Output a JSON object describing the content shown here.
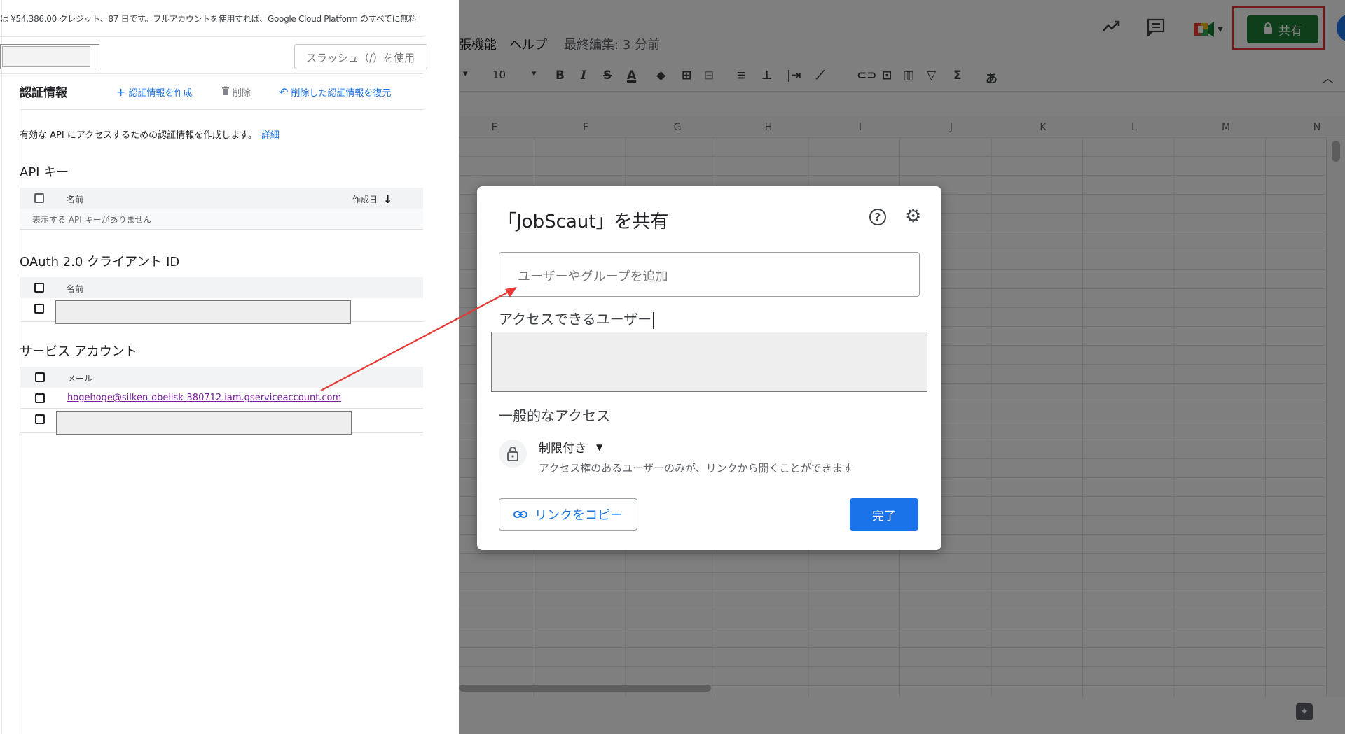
{
  "console": {
    "banner": "は ¥54,386.00 クレジット、87 日です。フルアカウントを使用すれば、Google Cloud Platform のすべてに無料",
    "search_placeholder": "スラッシュ（/）を使用",
    "credentials_title": "認証情報",
    "create_label": "認証情報を作成",
    "delete_label": "削除",
    "restore_label": "削除した認証情報を復元",
    "intro": "有効な API にアクセスするための認証情報を作成します。",
    "details_link": "詳細",
    "api_keys": {
      "title": "API キー",
      "col_name": "名前",
      "col_created": "作成日",
      "empty": "表示する API キーがありません"
    },
    "oauth": {
      "title": "OAuth 2.0 クライアント ID",
      "col_name": "名前"
    },
    "service_accounts": {
      "title": "サービス アカウント",
      "col_email": "メール",
      "email": "hogehoge@silken-obelisk-380712.iam.gserviceaccount.com"
    }
  },
  "sheets": {
    "menu_ext": "張機能",
    "menu_help": "ヘルプ",
    "last_edit": "最終編集: 3 分前",
    "share_label": "共有",
    "font_size": "10",
    "columns": [
      "E",
      "F",
      "G",
      "H",
      "I",
      "J",
      "K",
      "L",
      "M",
      "N"
    ]
  },
  "dialog": {
    "title": "「JobScaut」を共有",
    "add_placeholder": "ユーザーやグループを追加",
    "access_users_label": "アクセスできるユーザー",
    "general_access": "一般的なアクセス",
    "restricted": "制限付き",
    "restricted_desc": "アクセス権のあるユーザーのみが、リンクから開くことができます",
    "copy_link": "リンクをコピー",
    "done": "完了"
  },
  "colors": {
    "accent": "#1a73e8",
    "share_green": "#1e7e34",
    "highlight_red": "#e53935"
  }
}
